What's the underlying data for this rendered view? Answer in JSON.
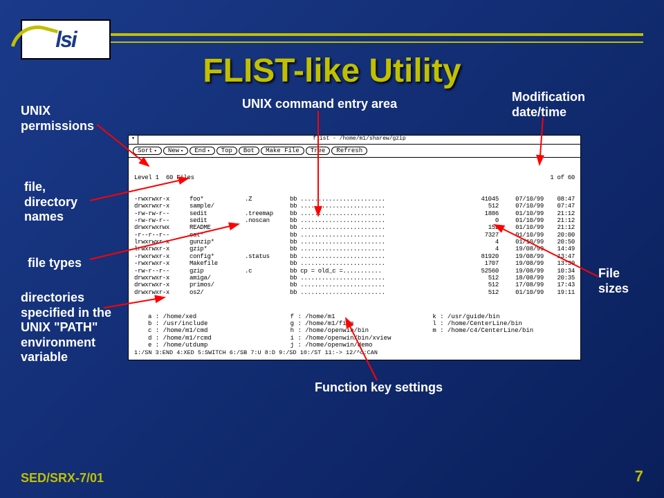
{
  "slide": {
    "title": "FLIST-like Utility",
    "footer_left": "SED/SRX-7/01",
    "footer_right": "7"
  },
  "labels": {
    "perm": "UNIX permissions",
    "names": "file, directory names",
    "types": "file types",
    "path": "directories specified in the UNIX \"PATH\" environment variable",
    "cmd": "UNIX  command  entry  area",
    "mod": "Modification date/time",
    "size": "File sizes",
    "fkey": "Function  key  settings"
  },
  "window": {
    "title": "flist - /home/m1/sharew/gzip",
    "buttons": [
      "Sort",
      "New",
      "End",
      "Top",
      "Bot",
      "Make File",
      "Tree",
      "Refresh"
    ],
    "btn_dropdown_idx": [
      0,
      1,
      2
    ],
    "header_left": "Level 1  60 Files",
    "header_right": "1 of 60",
    "rows": [
      {
        "perm": "-rwxrwxr-x",
        "name": "foo*",
        "ext": ".Z",
        "cmd": "bb ........................",
        "size": "41045",
        "date": "07/10/99",
        "time": "08:47"
      },
      {
        "perm": "drwxrwxr-x",
        "name": "sample/",
        "ext": "",
        "cmd": "bb ........................",
        "size": "512",
        "date": "07/10/99",
        "time": "07:47"
      },
      {
        "perm": "-rw-rw-r--",
        "name": "sedit",
        "ext": ".treemap",
        "cmd": "bb ........................",
        "size": "1886",
        "date": "01/10/99",
        "time": "21:12"
      },
      {
        "perm": "-rw-rw-r--",
        "name": "sedit",
        "ext": ".noscan",
        "cmd": "bb ........................",
        "size": "0",
        "date": "01/10/99",
        "time": "21:12"
      },
      {
        "perm": "drwxrwxrwx",
        "name": "README",
        "ext": "",
        "cmd": "bb ........................",
        "size": "152",
        "date": "01/10/99",
        "time": "21:12"
      },
      {
        "perm": "-r--r--r--",
        "name": "cat*",
        "ext": "",
        "cmd": "bb ........................",
        "size": "7327",
        "date": "01/10/99",
        "time": "20:00"
      },
      {
        "perm": "lrwxrwxr-x",
        "name": "gunzip*",
        "ext": "",
        "cmd": "bb ........................",
        "size": "4",
        "date": "01/10/99",
        "time": "20:50"
      },
      {
        "perm": "lrwxrwxr-x",
        "name": "gzip*",
        "ext": "",
        "cmd": "bb ........................",
        "size": "4",
        "date": "19/08/99",
        "time": "14:49"
      },
      {
        "perm": "-rwxrwxr-x",
        "name": "config*",
        "ext": ".status",
        "cmd": "bb ........................",
        "size": "81920",
        "date": "19/08/99",
        "time": "13:47"
      },
      {
        "perm": "-rwxrwxr-x",
        "name": "Makefile",
        "ext": "",
        "cmd": "bb ........................",
        "size": "1707",
        "date": "19/08/99",
        "time": "13:39"
      },
      {
        "perm": "-rw-r--r--",
        "name": "gzip",
        "ext": ".c",
        "cmd": "bb cp = old_c =...........",
        "size": "52560",
        "date": "19/08/99",
        "time": "10:34"
      },
      {
        "perm": "drwxrwxr-x",
        "name": "amiga/",
        "ext": "",
        "cmd": "bb ........................",
        "size": "512",
        "date": "18/08/99",
        "time": "20:35"
      },
      {
        "perm": "drwxrwxr-x",
        "name": "primos/",
        "ext": "",
        "cmd": "bb ........................",
        "size": "512",
        "date": "17/08/99",
        "time": "17:43"
      },
      {
        "perm": "drwxrwxr-x",
        "name": "os2/",
        "ext": "",
        "cmd": "bb ........................",
        "size": "512",
        "date": "01/10/99",
        "time": "19:11"
      }
    ],
    "paths": [
      {
        "k": "a",
        "p": "/home/xed"
      },
      {
        "k": "b",
        "p": "/usr/include"
      },
      {
        "k": "c",
        "p": "/home/m1/cmd"
      },
      {
        "k": "d",
        "p": "/home/m1/rcmd"
      },
      {
        "k": "e",
        "p": "/home/utdump"
      },
      {
        "k": "f",
        "p": "/home/m1"
      },
      {
        "k": "g",
        "p": "/home/m1/file"
      },
      {
        "k": "h",
        "p": "/home/openwin/bin"
      },
      {
        "k": "i",
        "p": "/home/openwin/bin/xview"
      },
      {
        "k": "j",
        "p": "/home/openwin/demo"
      },
      {
        "k": "k",
        "p": "/usr/guide/bin"
      },
      {
        "k": "l",
        "p": "/home/CenterLine/bin"
      },
      {
        "k": "m",
        "p": "/home/c4/CenterLine/bin"
      }
    ],
    "fkeys": "1:/SN  3:END  4:XED  5:SWITCH  6:/SB  7:U  8:D  9:/SD  10:/ST  11:->  12/^c:CAN"
  }
}
